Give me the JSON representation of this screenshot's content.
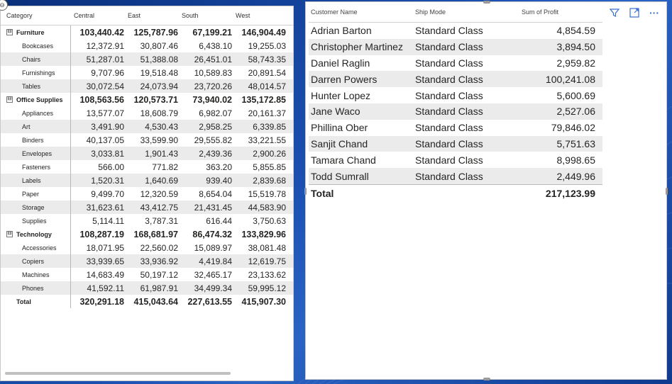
{
  "matrix": {
    "headers": [
      "Category",
      "Central",
      "East",
      "South",
      "West"
    ],
    "rows": [
      {
        "type": "group",
        "label": "Furniture",
        "expander": "⊟",
        "values": [
          "103,440.42",
          "125,787.96",
          "67,199.21",
          "146,904.49"
        ]
      },
      {
        "type": "sub",
        "label": "Bookcases",
        "values": [
          "12,372.91",
          "30,807.46",
          "6,438.10",
          "19,255.03"
        ]
      },
      {
        "type": "sub",
        "label": "Chairs",
        "values": [
          "51,287.01",
          "51,388.08",
          "26,451.01",
          "58,743.35"
        ]
      },
      {
        "type": "sub",
        "label": "Furnishings",
        "values": [
          "9,707.96",
          "19,518.48",
          "10,589.83",
          "20,891.54"
        ]
      },
      {
        "type": "sub",
        "label": "Tables",
        "values": [
          "30,072.54",
          "24,073.94",
          "23,720.26",
          "48,014.57"
        ]
      },
      {
        "type": "group",
        "label": "Office Supplies",
        "expander": "⊟",
        "values": [
          "108,563.56",
          "120,573.71",
          "73,940.02",
          "135,172.85"
        ]
      },
      {
        "type": "sub",
        "label": "Appliances",
        "values": [
          "13,577.07",
          "18,608.79",
          "6,982.07",
          "20,161.37"
        ]
      },
      {
        "type": "sub",
        "label": "Art",
        "values": [
          "3,491.90",
          "4,530.43",
          "2,958.25",
          "6,339.85"
        ]
      },
      {
        "type": "sub",
        "label": "Binders",
        "values": [
          "40,137.05",
          "33,599.90",
          "29,555.82",
          "33,221.55"
        ]
      },
      {
        "type": "sub",
        "label": "Envelopes",
        "values": [
          "3,033.81",
          "1,901.43",
          "2,439.36",
          "2,900.26"
        ]
      },
      {
        "type": "sub",
        "label": "Fasteners",
        "values": [
          "566.00",
          "771.82",
          "363.20",
          "5,855.85"
        ]
      },
      {
        "type": "sub",
        "label": "Labels",
        "values": [
          "1,520.31",
          "1,640.69",
          "939.40",
          "2,839.68"
        ]
      },
      {
        "type": "sub",
        "label": "Paper",
        "values": [
          "9,499.70",
          "12,320.59",
          "8,654.04",
          "15,519.78"
        ]
      },
      {
        "type": "sub",
        "label": "Storage",
        "values": [
          "31,623.61",
          "43,412.75",
          "21,431.45",
          "44,583.90"
        ]
      },
      {
        "type": "sub",
        "label": "Supplies",
        "values": [
          "5,114.11",
          "3,787.31",
          "616.44",
          "3,750.63"
        ]
      },
      {
        "type": "group",
        "label": "Technology",
        "expander": "⊟",
        "values": [
          "108,287.19",
          "168,681.97",
          "86,474.32",
          "133,829.96"
        ]
      },
      {
        "type": "sub",
        "label": "Accessories",
        "values": [
          "18,071.95",
          "22,560.02",
          "15,089.97",
          "38,081.48"
        ]
      },
      {
        "type": "sub",
        "label": "Copiers",
        "values": [
          "33,939.65",
          "33,936.92",
          "4,419.84",
          "12,619.75"
        ]
      },
      {
        "type": "sub",
        "label": "Machines",
        "values": [
          "14,683.49",
          "50,197.12",
          "32,465.17",
          "23,133.62"
        ]
      },
      {
        "type": "sub",
        "label": "Phones",
        "values": [
          "41,592.11",
          "61,987.91",
          "34,499.34",
          "59,995.12"
        ]
      },
      {
        "type": "total-row",
        "label": "Total",
        "values": [
          "320,291.18",
          "415,043.64",
          "227,613.55",
          "415,907.30"
        ]
      }
    ]
  },
  "table": {
    "headers": [
      "Customer Name",
      "Ship Mode",
      "Sum of Profit"
    ],
    "rows": [
      [
        "Adrian Barton",
        "Standard Class",
        "4,854.59"
      ],
      [
        "Christopher Martinez",
        "Standard Class",
        "3,894.50"
      ],
      [
        "Daniel Raglin",
        "Standard Class",
        "2,959.82"
      ],
      [
        "Darren Powers",
        "Standard Class",
        "100,241.08"
      ],
      [
        "Hunter Lopez",
        "Standard Class",
        "5,600.69"
      ],
      [
        "Jane Waco",
        "Standard Class",
        "2,527.06"
      ],
      [
        "Phillina Ober",
        "Standard Class",
        "79,846.02"
      ],
      [
        "Sanjit Chand",
        "Standard Class",
        "5,751.63"
      ],
      [
        "Tamara Chand",
        "Standard Class",
        "8,998.65"
      ],
      [
        "Todd Sumrall",
        "Standard Class",
        "2,449.96"
      ]
    ],
    "total_label": "Total",
    "total_value": "217,123.99"
  },
  "toolbar": {
    "icons": [
      "filter-icon",
      "focus-mode-icon",
      "more-options-icon"
    ],
    "more_glyph": "···"
  },
  "colors": {
    "accent": "#1a4fb0",
    "alt_row": "#ebebeb"
  }
}
